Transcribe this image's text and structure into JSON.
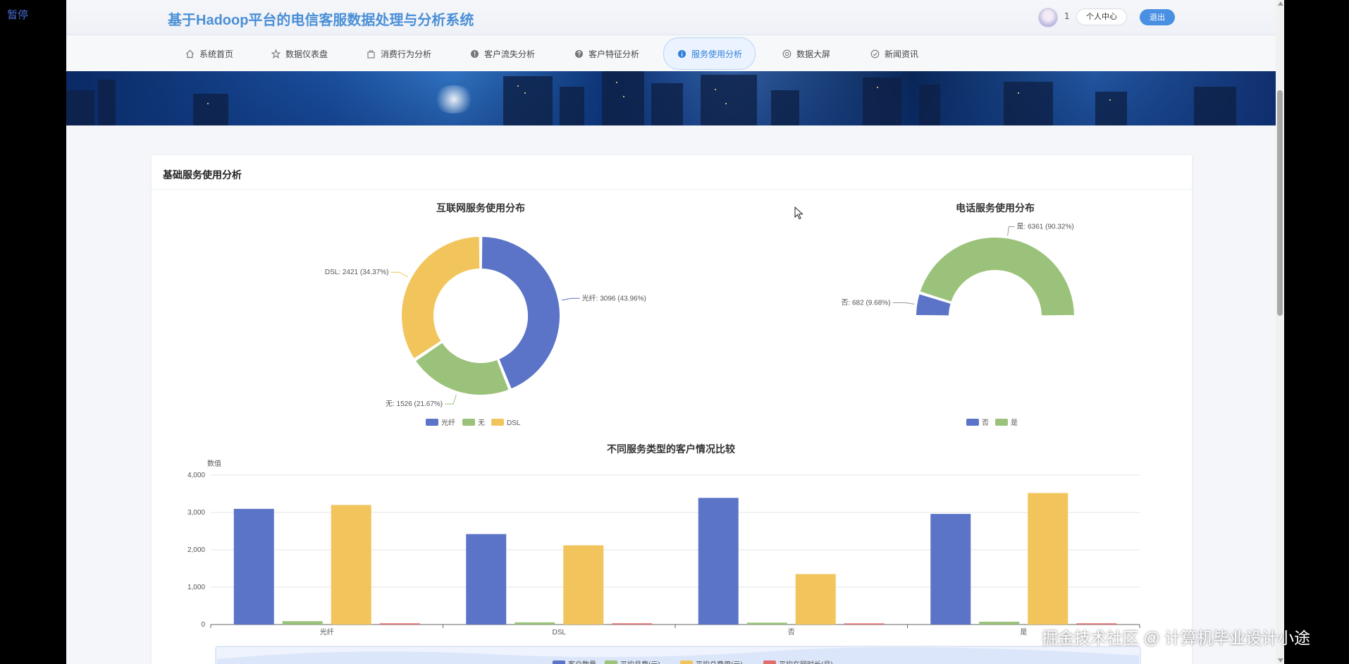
{
  "overlay": {
    "pause_label": "暂停"
  },
  "header": {
    "title": "基于Hadoop平台的电信客服数据处理与分析系统",
    "user_number": "1",
    "profile_label": "个人中心",
    "logout_label": "退出"
  },
  "nav": {
    "items": [
      {
        "label": "系统首页",
        "icon": "home-icon"
      },
      {
        "label": "数据仪表盘",
        "icon": "star-icon"
      },
      {
        "label": "消费行为分析",
        "icon": "bag-icon"
      },
      {
        "label": "客户流失分析",
        "icon": "alert-icon"
      },
      {
        "label": "客户特征分析",
        "icon": "help-icon"
      },
      {
        "label": "服务使用分析",
        "icon": "info-icon",
        "active": true
      },
      {
        "label": "数据大屏",
        "icon": "screen-icon"
      },
      {
        "label": "新闻资讯",
        "icon": "news-icon"
      }
    ]
  },
  "section": {
    "title": "基础服务使用分析"
  },
  "colors": {
    "blue": "#5b74c7",
    "green": "#9bc27a",
    "yellow": "#f2c55c",
    "red": "#e26d6d",
    "accent": "#4a90e2"
  },
  "chart_data": [
    {
      "type": "pie",
      "title": "互联网服务使用分布",
      "slices": [
        {
          "name": "光纤",
          "value": 3096,
          "label": "光纤: 3096 (43.96%)"
        },
        {
          "name": "无",
          "value": 1526,
          "label": "无: 1526 (21.67%)"
        },
        {
          "name": "DSL",
          "value": 2421,
          "label": "DSL: 2421 (34.37%)"
        }
      ],
      "legend": [
        "光纤",
        "无",
        "DSL"
      ],
      "legend_position": "bottom"
    },
    {
      "type": "pie",
      "title": "电话服务使用分布",
      "half_donut": true,
      "slices": [
        {
          "name": "否",
          "value": 682,
          "label": "否: 682 (9.68%)"
        },
        {
          "name": "是",
          "value": 6361,
          "label": "是: 6361 (90.32%)"
        }
      ],
      "legend": [
        "否",
        "是"
      ],
      "legend_position": "bottom"
    },
    {
      "type": "bar",
      "title": "不同服务类型的客户情况比较",
      "ylabel": "数值",
      "ylim": [
        0,
        4000
      ],
      "yticks": [
        "0",
        "1,000",
        "2,000",
        "3,000",
        "4,000"
      ],
      "categories": [
        "光纤",
        "DSL",
        "否",
        "是"
      ],
      "series": [
        {
          "name": "客户数量",
          "values": [
            3096,
            2421,
            3390,
            2960
          ]
        },
        {
          "name": "平均月费(元)",
          "values": [
            90,
            58,
            50,
            75
          ]
        },
        {
          "name": "平均总费用(元)",
          "values": [
            3200,
            2120,
            1350,
            3520
          ]
        },
        {
          "name": "平均在网时长(月)",
          "values": [
            33,
            33,
            31,
            33
          ]
        }
      ],
      "grid": true,
      "legend_position": "bottom"
    }
  ],
  "watermark": "掘金技术社区 @ 计算机毕业设计小途"
}
